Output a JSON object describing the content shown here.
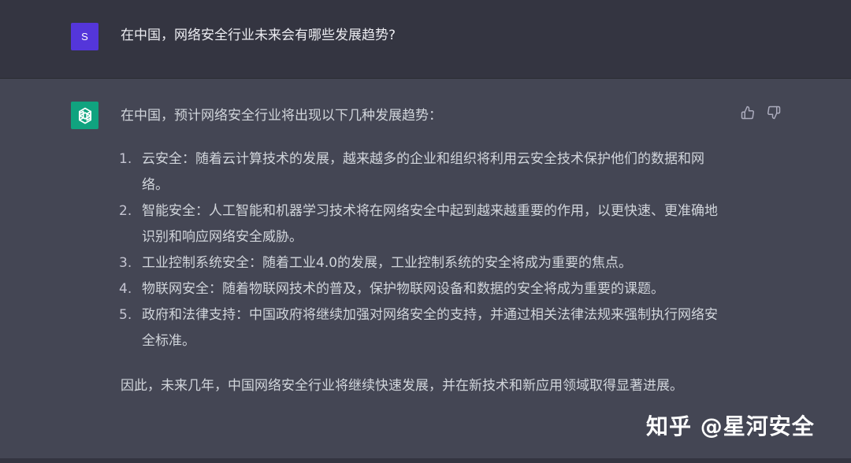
{
  "user_message": {
    "avatar_letter": "S",
    "text": "在中国，网络安全行业未来会有哪些发展趋势?"
  },
  "assistant_message": {
    "avatar_icon": "openai-logo-icon",
    "intro": "在中国，预计网络安全行业将出现以下几种发展趋势：",
    "items": [
      {
        "num": "1.",
        "text": "云安全：随着云计算技术的发展，越来越多的企业和组织将利用云安全技术保护他们的数据和网络。"
      },
      {
        "num": "2.",
        "text": "智能安全：人工智能和机器学习技术将在网络安全中起到越来越重要的作用，以更快速、更准确地识别和响应网络安全威胁。"
      },
      {
        "num": "3.",
        "text": "工业控制系统安全：随着工业4.0的发展，工业控制系统的安全将成为重要的焦点。"
      },
      {
        "num": "4.",
        "text": "物联网安全：随着物联网技术的普及，保护物联网设备和数据的安全将成为重要的课题。"
      },
      {
        "num": "5.",
        "text": "政府和法律支持：中国政府将继续加强对网络安全的支持，并通过相关法律法规来强制执行网络安全标准。"
      }
    ],
    "conclusion": "因此，未来几年，中国网络安全行业将继续快速发展，并在新技术和新应用领域取得显著进展。"
  },
  "feedback": {
    "thumbs_up_icon": "thumbs-up-icon",
    "thumbs_down_icon": "thumbs-down-icon"
  },
  "watermark": "知乎 @星河安全",
  "colors": {
    "user_bg": "#343541",
    "assistant_bg": "#444654",
    "user_avatar": "#5436da",
    "gpt_avatar": "#10a37f",
    "text": "#d1d5db"
  }
}
